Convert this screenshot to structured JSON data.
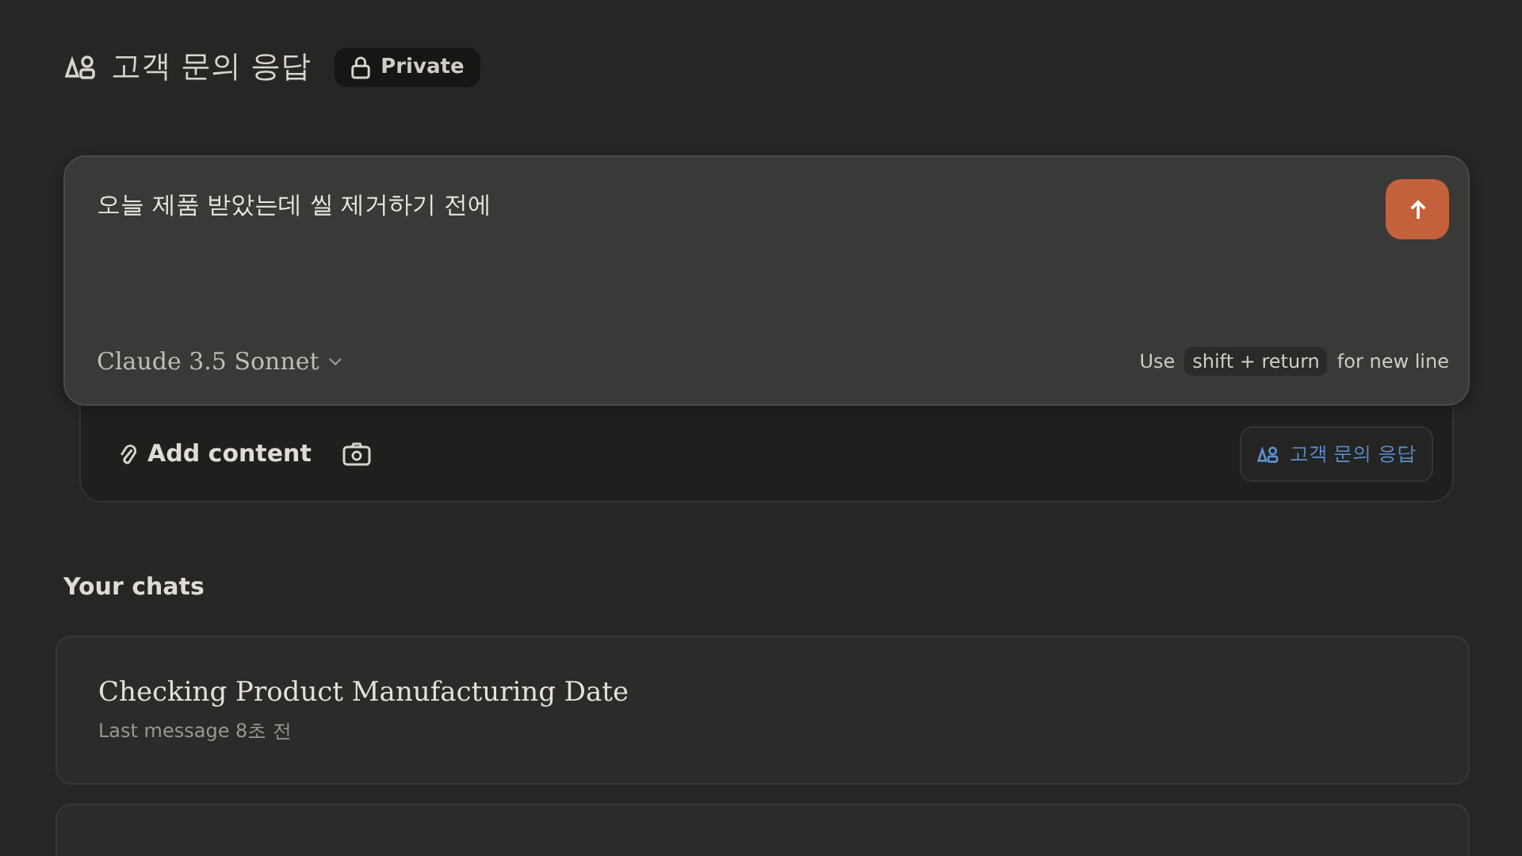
{
  "project": {
    "title": "고객 문의 응답",
    "visibility": "Private"
  },
  "composer": {
    "value": "오늘 제품 받았는데 씰 제거하기 전에",
    "model": "Claude 3.5 Sonnet",
    "hint_before": "Use",
    "hint_key": "shift + return",
    "hint_after": "for new line"
  },
  "attachments": {
    "add_label": "Add content",
    "project_chip": "고객 문의 응답"
  },
  "chats_heading": "Your chats",
  "chats": [
    {
      "title": "Checking Product Manufacturing Date",
      "meta": "Last message 8초 전"
    }
  ]
}
